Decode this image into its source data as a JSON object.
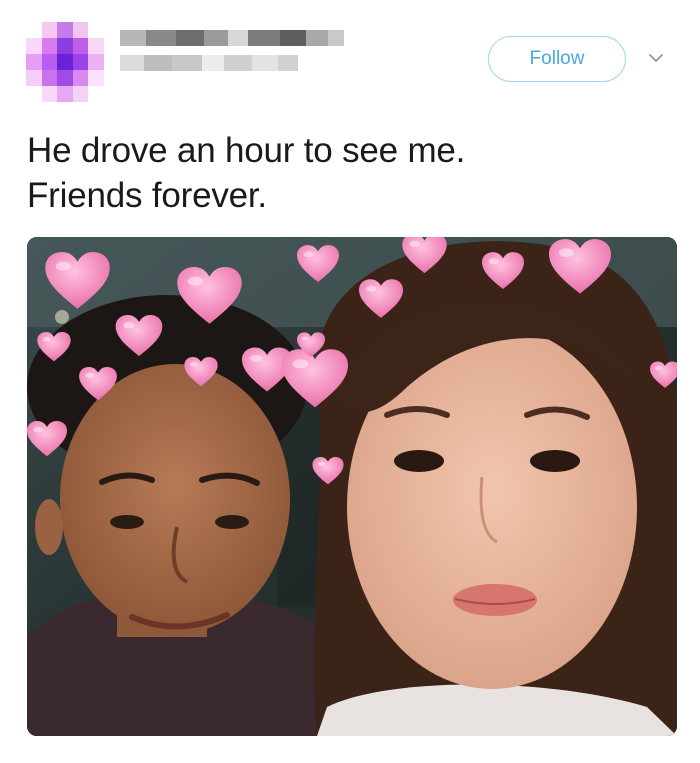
{
  "header": {
    "avatar_icon": "pixelated-avatar-icon",
    "follow_label": "Follow",
    "chevron_icon": "chevron-down-icon"
  },
  "tweet": {
    "line1": "He drove an hour to see me.",
    "line2": "Friends forever."
  },
  "media": {
    "type": "selfie-photo"
  },
  "colors": {
    "follow_border": "#9fd6f2",
    "follow_text": "#4aa8db",
    "text": "#1a1a1a",
    "heart": "#f07fb3"
  }
}
